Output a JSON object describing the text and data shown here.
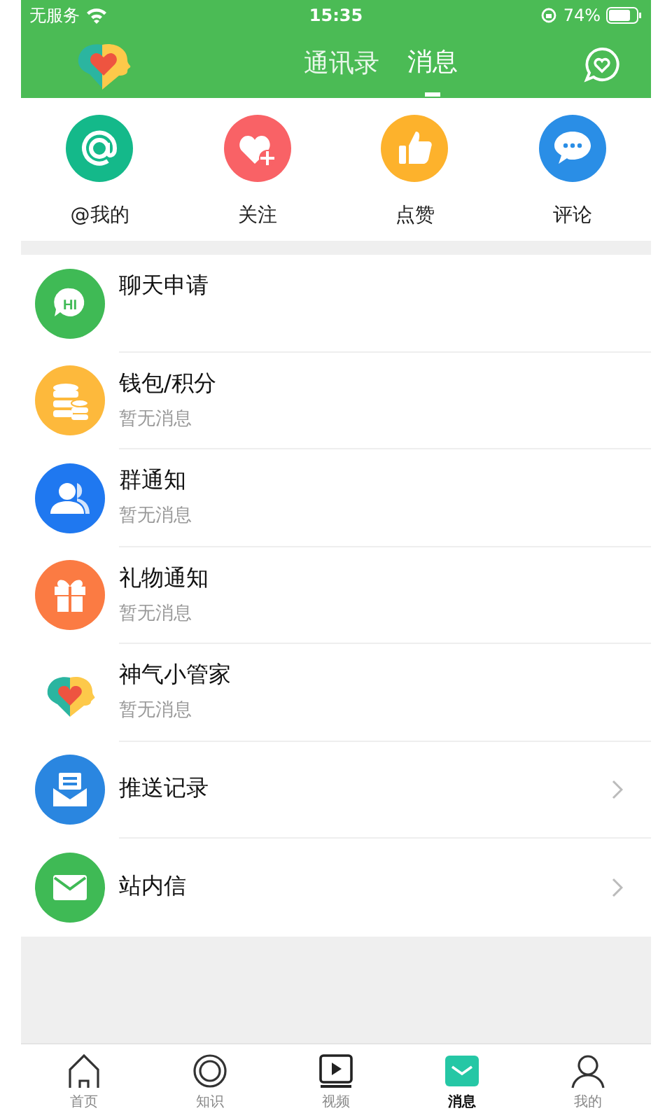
{
  "status_bar": {
    "carrier": "无服务",
    "time": "15:35",
    "battery": "74%"
  },
  "header": {
    "tabs": [
      {
        "label": "通讯录",
        "selected": false
      },
      {
        "label": "消息",
        "selected": true
      }
    ]
  },
  "quick_actions": [
    {
      "label": "@我的",
      "kind": "at",
      "color": "#14b98a"
    },
    {
      "label": "关注",
      "kind": "heart",
      "color": "#f96266"
    },
    {
      "label": "点赞",
      "kind": "like",
      "color": "#fdb22c"
    },
    {
      "label": "评论",
      "kind": "comment",
      "color": "#2a8ee6"
    }
  ],
  "messages": [
    {
      "title": "聊天申请",
      "kind": "chat",
      "icon_text": "HI",
      "chevron": false
    },
    {
      "title": "钱包/积分",
      "subtitle": "暂无消息",
      "kind": "wallet",
      "chevron": false
    },
    {
      "title": "群通知",
      "subtitle": "暂无消息",
      "kind": "group",
      "chevron": false
    },
    {
      "title": "礼物通知",
      "subtitle": "暂无消息",
      "kind": "gift",
      "chevron": false
    },
    {
      "title": "神气小管家",
      "subtitle": "暂无消息",
      "kind": "logo",
      "chevron": false
    },
    {
      "title": "推送记录",
      "kind": "push",
      "chevron": true
    },
    {
      "title": "站内信",
      "kind": "mail",
      "chevron": true
    }
  ],
  "bottom_nav": [
    {
      "label": "首页",
      "kind": "home",
      "selected": false
    },
    {
      "label": "知识",
      "kind": "knowledge",
      "selected": false
    },
    {
      "label": "视频",
      "kind": "video",
      "selected": false
    },
    {
      "label": "消息",
      "kind": "message",
      "selected": true
    },
    {
      "label": "我的",
      "kind": "profile",
      "selected": false
    }
  ]
}
